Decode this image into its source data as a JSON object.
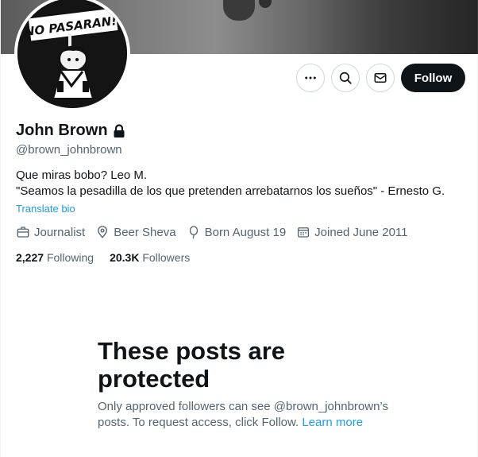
{
  "profile": {
    "name": "John Brown",
    "handle": "@brown_johnbrown",
    "bio_line1": "Que miras bobo? Leo M.",
    "bio_line2": "\"Seamos la pesadilla de los que pretenden arrebatarnos los sueños\" - Ernesto G.",
    "translate_label": "Translate bio",
    "avatar_sign_text": "NO PASARAN!!"
  },
  "meta": {
    "profession": "Journalist",
    "location": "Beer Sheva",
    "birthday": "Born August 19",
    "joined": "Joined June 2011"
  },
  "stats": {
    "following_count": "2,227",
    "following_label": "Following",
    "followers_count": "20.3K",
    "followers_label": "Followers"
  },
  "actions": {
    "follow_label": "Follow"
  },
  "protected": {
    "title": "These posts are protected",
    "body": "Only approved followers can see @brown_johnbrown’s posts. To request access, click Follow.",
    "learn_more": "Learn more"
  },
  "colors": {
    "accent": "#1d9bf0",
    "text": "#0f1419",
    "muted": "#536471",
    "border": "#cfd9de"
  }
}
